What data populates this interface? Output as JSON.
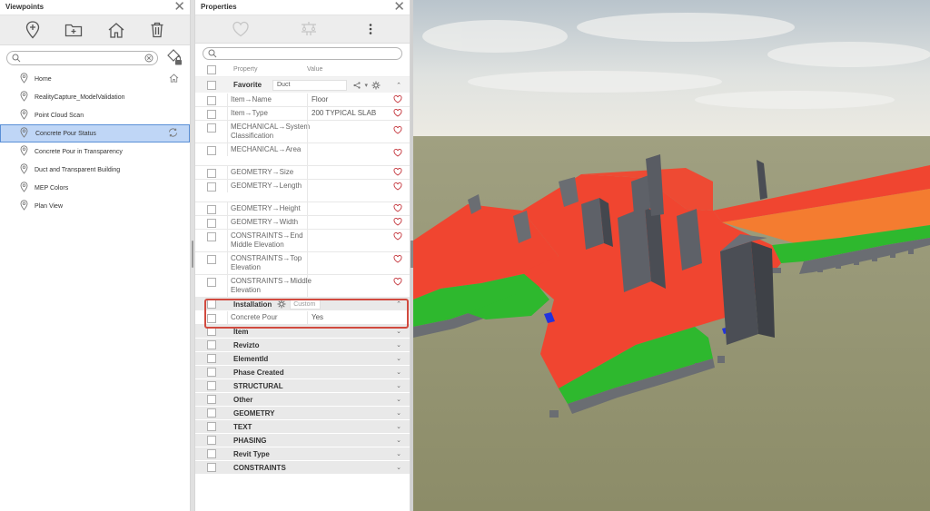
{
  "viewpoints": {
    "title": "Viewpoints",
    "search_value": "",
    "items": [
      {
        "label": "Home"
      },
      {
        "label": "RealityCapture_ModelValidation"
      },
      {
        "label": "Point Cloud Scan"
      },
      {
        "label": "Concrete Pour Status"
      },
      {
        "label": "Concrete Pour in Transparency"
      },
      {
        "label": "Duct and Transparent Building"
      },
      {
        "label": "MEP Colors"
      },
      {
        "label": "Plan View"
      }
    ],
    "selected_index": 3
  },
  "properties": {
    "title": "Properties",
    "search_value": "",
    "col_property": "Property",
    "col_value": "Value",
    "favorite": {
      "label": "Favorite",
      "tag": "Duct",
      "rows": [
        {
          "property": "Item→Name",
          "value": "Floor"
        },
        {
          "property": "Item→Type",
          "value": "200 TYPICAL SLAB"
        },
        {
          "property": "MECHANICAL→System Classification",
          "value": ""
        },
        {
          "property": "MECHANICAL→Area",
          "value": ""
        },
        {
          "property": "GEOMETRY→Size",
          "value": ""
        },
        {
          "property": "GEOMETRY→Length",
          "value": ""
        },
        {
          "property": "GEOMETRY→Height",
          "value": ""
        },
        {
          "property": "GEOMETRY→Width",
          "value": ""
        },
        {
          "property": "CONSTRAINTS→End Middle Elevation",
          "value": ""
        },
        {
          "property": "CONSTRAINTS→Top Elevation",
          "value": ""
        },
        {
          "property": "CONSTRAINTS→Middle Elevation",
          "value": ""
        }
      ]
    },
    "installation": {
      "label": "Installation",
      "tag": "Custom",
      "row": {
        "property": "Concrete Pour",
        "value": "Yes"
      }
    },
    "groups": [
      "Item",
      "Revizto",
      "ElementId",
      "Phase Created",
      "STRUCTURAL",
      "Other",
      "GEOMETRY",
      "TEXT",
      "PHASING",
      "Revit Type",
      "CONSTRAINTS"
    ]
  },
  "colors": {
    "selection": "#bfd6f6",
    "highlight_box": "#d14a3f",
    "poured": "#2eb82e",
    "not_poured": "#f04530",
    "in_progress": "#f47c30"
  }
}
